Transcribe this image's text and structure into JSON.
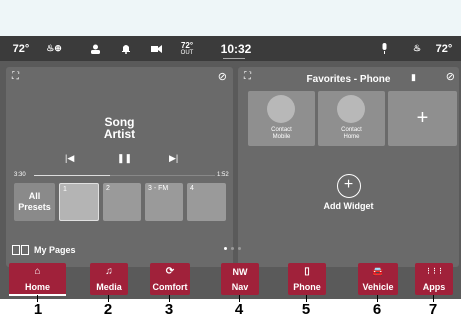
{
  "status_bar": {
    "left_temp": "72°",
    "right_temp": "72°",
    "outside_temp": "72°",
    "outside_label": "OUT",
    "clock": "10:32"
  },
  "media_panel": {
    "song": "Song",
    "artist": "Artist",
    "time_elapsed": "3:30",
    "time_total": "1:52",
    "progress": 0.42,
    "presets": [
      {
        "label": "All\nPresets"
      },
      {
        "label": "1"
      },
      {
        "label": "2"
      },
      {
        "label": "3 - FM"
      },
      {
        "label": "4"
      }
    ]
  },
  "favorites_panel": {
    "title": "Favorites - Phone",
    "contacts": [
      {
        "label": "Contact\nMobile"
      },
      {
        "label": "Contact\nHome"
      }
    ],
    "add_symbol": "+",
    "add_widget_label": "Add Widget"
  },
  "my_pages_label": "My Pages",
  "nav": [
    {
      "label": "Home",
      "icon": "⌂"
    },
    {
      "label": "Media",
      "icon": "♫"
    },
    {
      "label": "Comfort",
      "icon": "⟳"
    },
    {
      "label": "Nav",
      "icon": "NW"
    },
    {
      "label": "Phone",
      "icon": "▯"
    },
    {
      "label": "Vehicle",
      "icon": "🚘"
    },
    {
      "label": "Apps",
      "icon": "⋮⋮⋮"
    }
  ],
  "callouts": [
    "1",
    "2",
    "3",
    "4",
    "5",
    "6",
    "7"
  ]
}
